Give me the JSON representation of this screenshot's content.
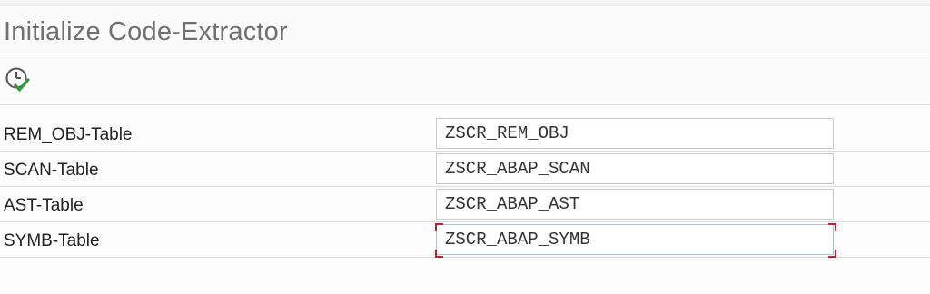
{
  "header": {
    "title": "Initialize Code-Extractor"
  },
  "toolbar": {
    "execute_icon": "clock-check-icon"
  },
  "form": {
    "rows": [
      {
        "label": "REM_OBJ-Table",
        "value": "ZSCR_REM_OBJ"
      },
      {
        "label": "SCAN-Table",
        "value": "ZSCR_ABAP_SCAN"
      },
      {
        "label": "AST-Table",
        "value": "ZSCR_ABAP_AST"
      },
      {
        "label": "SYMB-Table",
        "value": "ZSCR_ABAP_SYMB"
      }
    ],
    "focused_row": 3
  },
  "colors": {
    "title_text": "#707070",
    "focus_corner": "#c0202a",
    "execute_check": "#2e9e3f"
  }
}
